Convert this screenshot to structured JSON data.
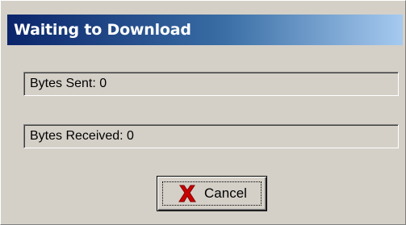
{
  "dialog": {
    "title": "Waiting to Download"
  },
  "status": {
    "bytes_sent": "Bytes Sent: 0",
    "bytes_received": "Bytes Received: 0"
  },
  "actions": {
    "cancel_label": "Cancel",
    "cancel_icon": "red-x-icon"
  },
  "colors": {
    "titlebar_start": "#0a246a",
    "titlebar_end": "#a6caf0",
    "window_face": "#d4d0c8",
    "cancel_icon": "#cc0000"
  }
}
